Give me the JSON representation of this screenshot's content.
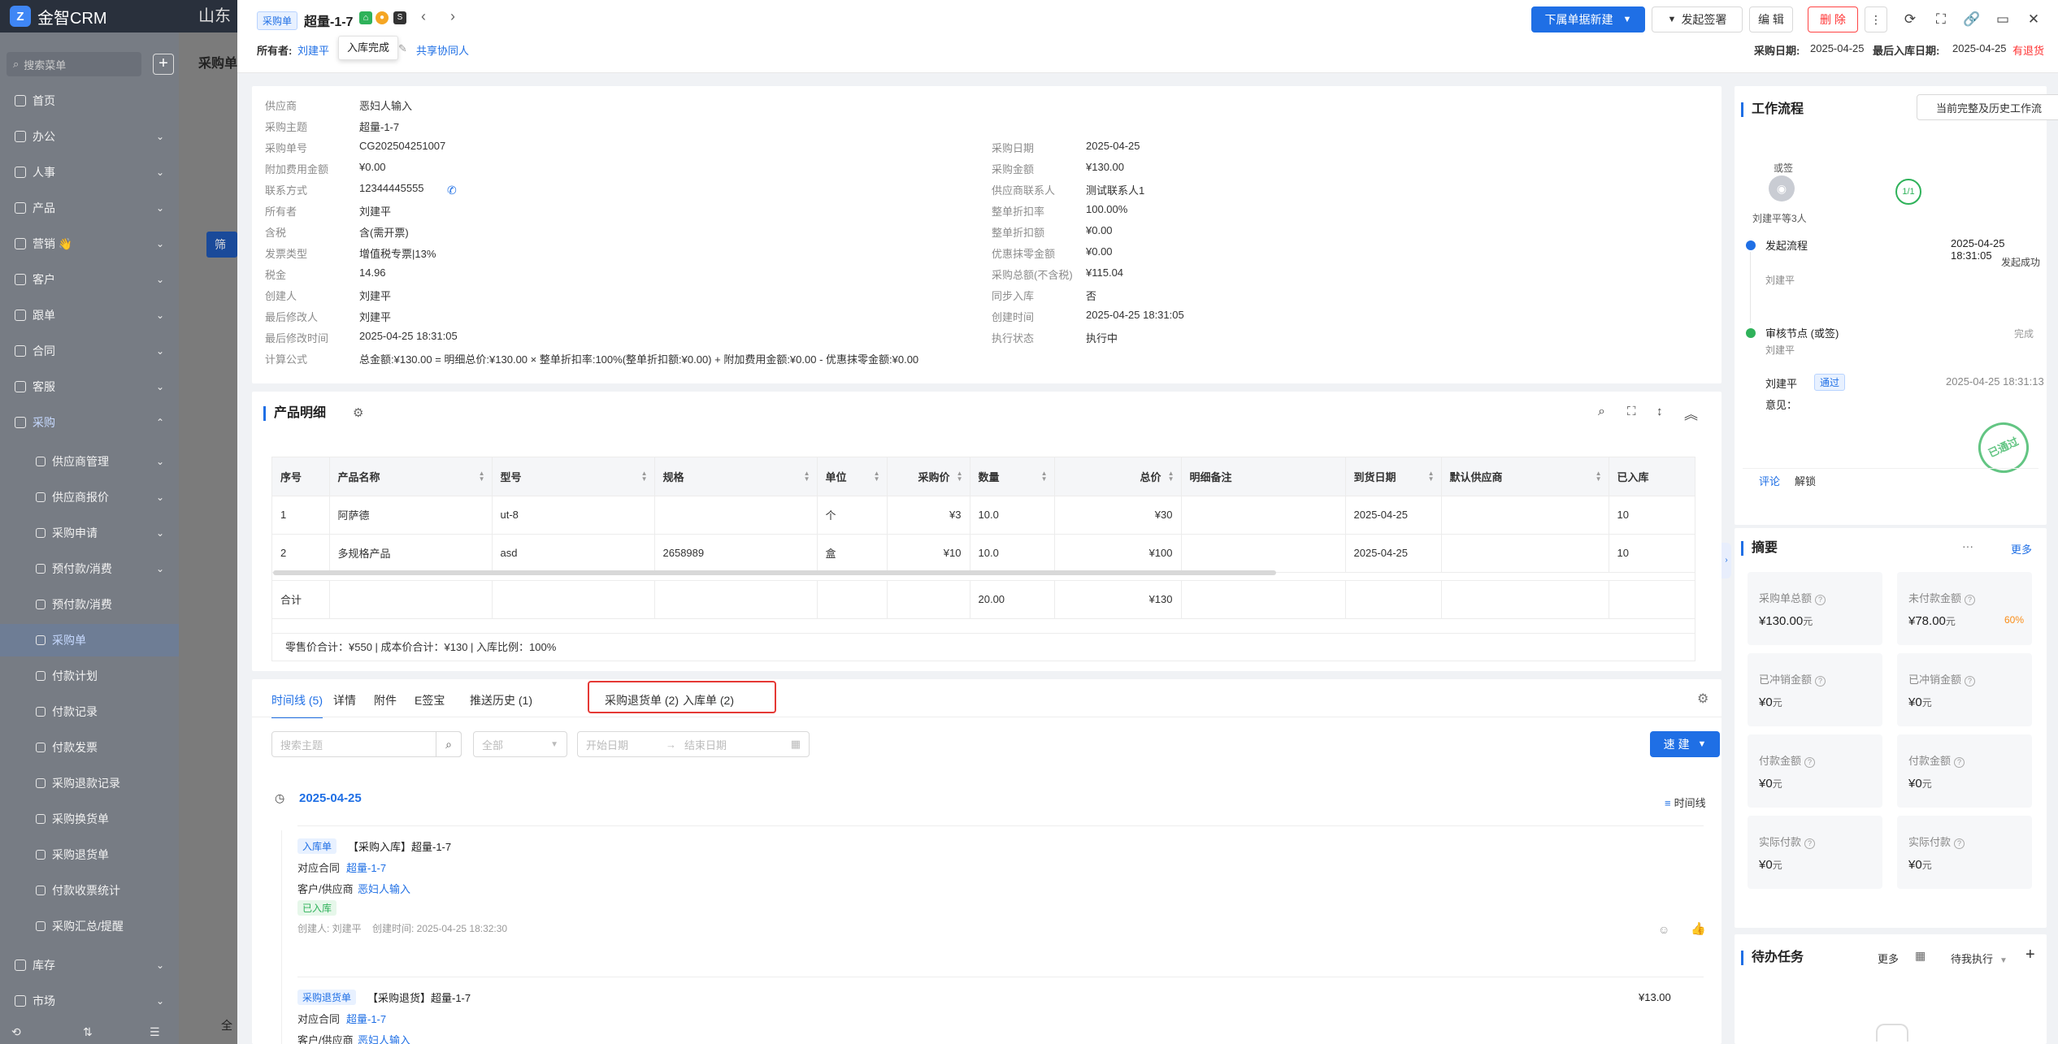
{
  "app": {
    "name": "金智CRM",
    "behind_title": "山东",
    "search_placeholder": "搜索菜单",
    "page_tab": "采购单",
    "filter_btn": "筛"
  },
  "sidebar": {
    "items": [
      {
        "label": "首页",
        "chev": false
      },
      {
        "label": "办公",
        "chev": true
      },
      {
        "label": "人事",
        "chev": true
      },
      {
        "label": "产品",
        "chev": true
      },
      {
        "label": "营销 👋",
        "chev": true
      },
      {
        "label": "客户",
        "chev": true
      },
      {
        "label": "跟单",
        "chev": true
      },
      {
        "label": "合同",
        "chev": true
      },
      {
        "label": "客服",
        "chev": true
      },
      {
        "label": "采购",
        "chev": true
      }
    ],
    "sub_items": [
      {
        "label": "供应商管理",
        "chev": true
      },
      {
        "label": "供应商报价",
        "chev": true
      },
      {
        "label": "采购申请",
        "chev": true
      },
      {
        "label": "预付款/消费",
        "chev": true
      },
      {
        "label": "预付款/消费",
        "chev": false
      },
      {
        "label": "采购单",
        "chev": false
      },
      {
        "label": "付款计划",
        "chev": false
      },
      {
        "label": "付款记录",
        "chev": false
      },
      {
        "label": "付款发票",
        "chev": false
      },
      {
        "label": "采购退款记录",
        "chev": false
      },
      {
        "label": "采购换货单",
        "chev": false
      },
      {
        "label": "采购退货单",
        "chev": false
      },
      {
        "label": "付款收票统计",
        "chev": false
      },
      {
        "label": "采购汇总/提醒",
        "chev": false
      }
    ],
    "bottom_items": [
      {
        "label": "库存",
        "chev": true
      },
      {
        "label": "市场",
        "chev": true
      }
    ],
    "footer_all": "全"
  },
  "header": {
    "type_tag": "采购单",
    "title": "超量-1-7",
    "owner_label": "所有者:",
    "owner": "刘建平",
    "tooltip": "入库完成",
    "share": "共享协同人",
    "btn_new": "下属单据新建",
    "btn_sign": "发起签署",
    "btn_edit": "编 辑",
    "btn_delete": "删 除",
    "purchase_date_label": "采购日期:",
    "purchase_date": "2025-04-25",
    "last_in_label": "最后入库日期:",
    "last_in": "2025-04-25",
    "in_status": "有退货"
  },
  "detail": {
    "left": [
      {
        "k": "供应商",
        "v": "恶妇人输入",
        "link": true
      },
      {
        "k": "采购主题",
        "v": "超量-1-7"
      },
      {
        "k": "采购单号",
        "v": "CG202504251007"
      },
      {
        "k": "附加费用金额",
        "v": "¥0.00"
      },
      {
        "k": "联系方式",
        "v": "12344445555"
      },
      {
        "k": "所有者",
        "v": "刘建平"
      },
      {
        "k": "含税",
        "v": "含(需开票)"
      },
      {
        "k": "发票类型",
        "v": "增值税专票|13%"
      },
      {
        "k": "税金",
        "v": "14.96"
      },
      {
        "k": "创建人",
        "v": "刘建平"
      },
      {
        "k": "最后修改人",
        "v": "刘建平"
      },
      {
        "k": "最后修改时间",
        "v": "2025-04-25 18:31:05"
      },
      {
        "k": "计算公式",
        "v": "总金额:¥130.00 = 明细总价:¥130.00 × 整单折扣率:100%(整单折扣额:¥0.00) + 附加费用金额:¥0.00 - 优惠抹零金额:¥0.00"
      }
    ],
    "right": [
      {
        "k": "采购日期",
        "v": "2025-04-25"
      },
      {
        "k": "采购金额",
        "v": "¥130.00"
      },
      {
        "k": "供应商联系人",
        "v": "测试联系人1",
        "link": true
      },
      {
        "k": "整单折扣率",
        "v": "100.00%"
      },
      {
        "k": "整单折扣额",
        "v": "¥0.00"
      },
      {
        "k": "优惠抹零金额",
        "v": "¥0.00"
      },
      {
        "k": "采购总额(不含税)",
        "v": "¥115.04"
      },
      {
        "k": "同步入库",
        "v": "否"
      },
      {
        "k": "创建时间",
        "v": "2025-04-25 18:31:05"
      },
      {
        "k": "执行状态",
        "v": "执行中"
      }
    ]
  },
  "products": {
    "title": "产品明细",
    "columns": [
      "序号",
      "产品名称",
      "型号",
      "规格",
      "单位",
      "采购价",
      "数量",
      "总价",
      "明细备注",
      "到货日期",
      "默认供应商",
      "已入库"
    ],
    "rows": [
      [
        "1",
        "阿萨德",
        "ut-8",
        "",
        "个",
        "¥3",
        "10.0",
        "¥30",
        "",
        "2025-04-25",
        "",
        "10"
      ],
      [
        "2",
        "多规格产品",
        "asd",
        "2658989",
        "盒",
        "¥10",
        "10.0",
        "¥100",
        "",
        "2025-04-25",
        "",
        "10"
      ]
    ],
    "total_label": "合计",
    "total_qty": "20.00",
    "total_amount": "¥130",
    "summary": "零售价合计：¥550 | 成本价合计：¥130 | 入库比例：100%"
  },
  "tabs": {
    "items": [
      "时间线 (5)",
      "详情",
      "附件",
      "E签宝",
      "推送历史 (1)",
      "采购退货单 (2)",
      "入库单 (2)"
    ],
    "search_placeholder": "搜索主题",
    "select": "全部",
    "start_placeholder": "开始日期",
    "end_placeholder": "结束日期",
    "quick_new": "速 建",
    "timeline_toggle": "时间线"
  },
  "timeline": {
    "date": "2025-04-25",
    "entries": [
      {
        "tag": "入库单",
        "title": "【采购入库】超量-1-7",
        "contract_label": "对应合同",
        "contract": "超量-1-7",
        "supplier_label": "客户/供应商",
        "supplier": "恶妇人输入",
        "status": "已入库",
        "meta": "创建人: 刘建平    创建时间: 2025-04-25 18:32:30"
      },
      {
        "tag": "采购退货单",
        "title": "【采购退货】超量-1-7",
        "contract_label": "对应合同",
        "contract": "超量-1-7",
        "supplier_label": "客户/供应商",
        "supplier": "恶妇人输入",
        "amount": "¥13.00"
      }
    ]
  },
  "workflow": {
    "title": "工作流程",
    "history_btn": "当前完整及历史工作流",
    "sign_type": "或签",
    "approvers": "刘建平等3人",
    "progress": "1/1",
    "start_label": "发起流程",
    "start_time": "2025-04-25 18:31:05",
    "start_status": "发起成功",
    "start_user": "刘建平",
    "node_label": "审核节点 (或签)",
    "node_status": "完成",
    "node_user": "刘建平",
    "approver": "刘建平",
    "approve_tag": "通过",
    "approve_time": "2025-04-25 18:31:13",
    "opinion": "意见：",
    "stamp": "已通过",
    "comment": "评论",
    "unlock": "解锁"
  },
  "summary": {
    "title": "摘要",
    "more": "更多",
    "stats": [
      {
        "label": "采购单总额",
        "value": "¥130.00",
        "unit": "元"
      },
      {
        "label": "未付款金额",
        "value": "¥78.00",
        "unit": "元",
        "pct": "60%"
      },
      {
        "label": "已冲销金额",
        "value": "¥0",
        "unit": "元"
      },
      {
        "label": "已冲销金额",
        "value": "¥0",
        "unit": "元"
      },
      {
        "label": "付款金额",
        "value": "¥0",
        "unit": "元"
      },
      {
        "label": "付款金额",
        "value": "¥0",
        "unit": "元"
      },
      {
        "label": "实际付款",
        "value": "¥0",
        "unit": "元"
      },
      {
        "label": "实际付款",
        "value": "¥0",
        "unit": "元"
      }
    ]
  },
  "todo": {
    "title": "待办任务",
    "more": "更多",
    "filter": "待我执行"
  },
  "colors": {
    "primary": "#1f6fe5",
    "danger": "#ff4d4f",
    "highlight_box": "#e53935",
    "green": "#2fb25a",
    "orange": "#fa8c16"
  }
}
